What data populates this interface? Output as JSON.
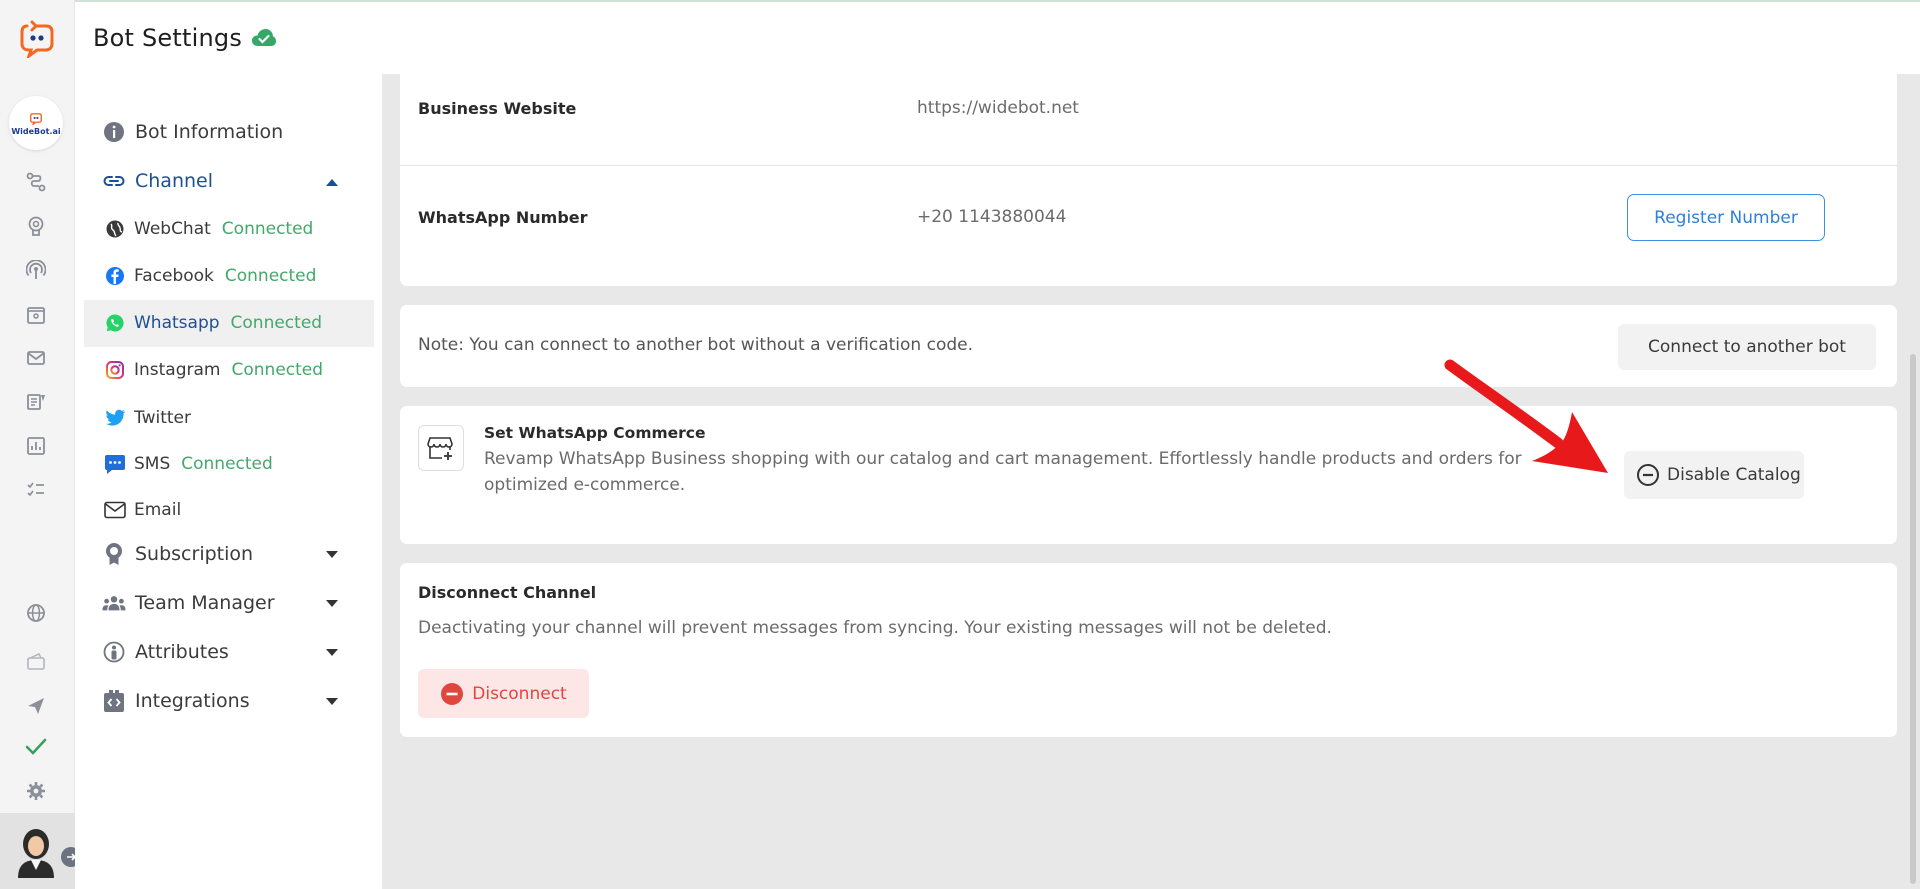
{
  "header": {
    "title": "Bot Settings"
  },
  "rail": {
    "bot_badge": "WideBot.ai"
  },
  "nav": {
    "bot_information": "Bot Information",
    "channel": "Channel",
    "channels": [
      {
        "name": "WebChat",
        "status": "Connected"
      },
      {
        "name": "Facebook",
        "status": "Connected"
      },
      {
        "name": "Whatsapp",
        "status": "Connected"
      },
      {
        "name": "Instagram",
        "status": "Connected"
      },
      {
        "name": "Twitter",
        "status": ""
      },
      {
        "name": "SMS",
        "status": "Connected"
      },
      {
        "name": "Email",
        "status": ""
      }
    ],
    "subscription": "Subscription",
    "team_manager": "Team Manager",
    "attributes": "Attributes",
    "integrations": "Integrations"
  },
  "main": {
    "business_website_label": "Business Website",
    "business_website_value": "https://widebot.net",
    "whatsapp_number_label": "WhatsApp Number",
    "whatsapp_number_value": "+20 1143880044",
    "register_button": "Register Number",
    "note_text": "Note: You can connect to another bot without a verification code.",
    "connect_button": "Connect to another bot",
    "commerce_title": "Set WhatsApp Commerce",
    "commerce_desc_line1": "Revamp WhatsApp Business shopping with our catalog and cart management. Effortlessly handle products and orders for",
    "commerce_desc_line2": "optimized e-commerce.",
    "disable_catalog_button": "Disable Catalog",
    "disconnect_title": "Disconnect Channel",
    "disconnect_desc": "Deactivating your channel will prevent messages from syncing. Your existing messages will not be deleted.",
    "disconnect_button": "Disconnect"
  },
  "colors": {
    "accent_blue": "#1e4f95",
    "connected_green": "#43a86a",
    "danger_red": "#e0463e",
    "annotation_arrow": "#e8191b"
  }
}
